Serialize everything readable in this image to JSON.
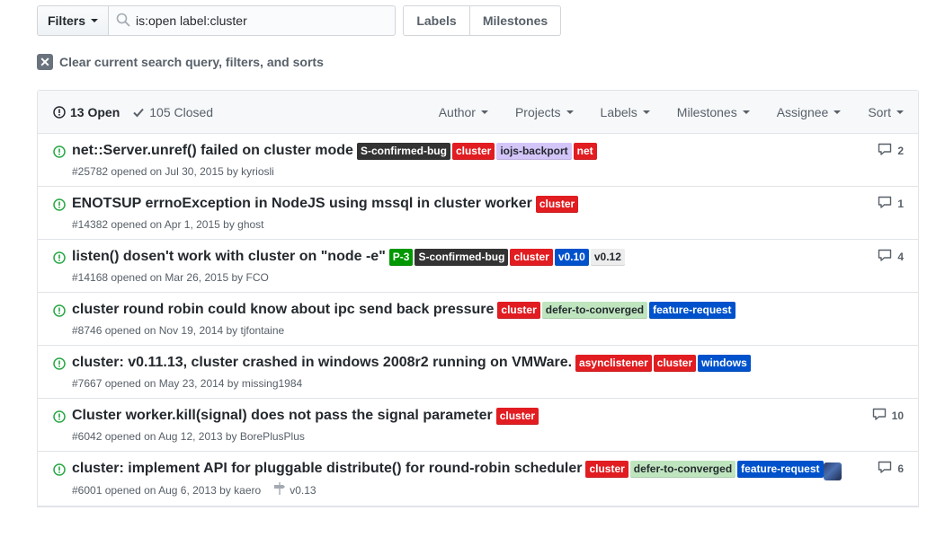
{
  "filter_bar": {
    "filters_label": "Filters",
    "search_value": "is:open label:cluster",
    "labels_button": "Labels",
    "milestones_button": "Milestones"
  },
  "clear_query": {
    "label": "Clear current search query, filters, and sorts"
  },
  "header": {
    "open_count": "13 Open",
    "closed_count": "105 Closed",
    "filters": [
      "Author",
      "Projects",
      "Labels",
      "Milestones",
      "Assignee",
      "Sort"
    ]
  },
  "colors": {
    "open_green": "#28a745",
    "S-confirmed-bug": "#333333",
    "cluster": "#e11d21",
    "iojs-backport": "#d4c5f9",
    "net": "#e11d21",
    "P-3": "#009800",
    "v0.10": "#0052cc",
    "v0.12": "#ededed",
    "defer-to-converged": "#bfe5bf",
    "feature-request": "#0052cc",
    "asynclistener": "#e11d21",
    "windows": "#0052cc"
  },
  "issues": [
    {
      "title": "net::Server.unref() failed on cluster mode",
      "labels": [
        {
          "name": "S-confirmed-bug",
          "bg": "#333333",
          "fg": "#ffffff"
        },
        {
          "name": "cluster",
          "bg": "#e11d21",
          "fg": "#ffffff"
        },
        {
          "name": "iojs-backport",
          "bg": "#d4c5f9",
          "fg": "#24292e"
        },
        {
          "name": "net",
          "bg": "#e11d21",
          "fg": "#ffffff"
        }
      ],
      "meta": "#25782 opened on Jul 30, 2015 by kyriosli",
      "comments": "2"
    },
    {
      "title": "ENOTSUP errnoException in NodeJS using mssql in cluster worker",
      "labels": [
        {
          "name": "cluster",
          "bg": "#e11d21",
          "fg": "#ffffff"
        }
      ],
      "meta": "#14382 opened on Apr 1, 2015 by ghost",
      "comments": "1"
    },
    {
      "title": "listen() dosen't work with cluster on \"node -e\"",
      "labels": [
        {
          "name": "P-3",
          "bg": "#009800",
          "fg": "#ffffff"
        },
        {
          "name": "S-confirmed-bug",
          "bg": "#333333",
          "fg": "#ffffff"
        },
        {
          "name": "cluster",
          "bg": "#e11d21",
          "fg": "#ffffff"
        },
        {
          "name": "v0.10",
          "bg": "#0052cc",
          "fg": "#ffffff"
        },
        {
          "name": "v0.12",
          "bg": "#ededed",
          "fg": "#24292e"
        }
      ],
      "meta": "#14168 opened on Mar 26, 2015 by FCO",
      "comments": "4"
    },
    {
      "title": "cluster round robin could know about ipc send back pressure",
      "labels": [
        {
          "name": "cluster",
          "bg": "#e11d21",
          "fg": "#ffffff"
        },
        {
          "name": "defer-to-converged",
          "bg": "#bfe5bf",
          "fg": "#24292e"
        },
        {
          "name": "feature-request",
          "bg": "#0052cc",
          "fg": "#ffffff"
        }
      ],
      "meta": "#8746 opened on Nov 19, 2014 by tjfontaine",
      "comments": ""
    },
    {
      "title": "cluster: v0.11.13, cluster crashed in windows 2008r2 running on VMWare.",
      "labels": [
        {
          "name": "asynclistener",
          "bg": "#e11d21",
          "fg": "#ffffff"
        },
        {
          "name": "cluster",
          "bg": "#e11d21",
          "fg": "#ffffff"
        },
        {
          "name": "windows",
          "bg": "#0052cc",
          "fg": "#ffffff"
        }
      ],
      "meta": "#7667 opened on May 23, 2014 by missing1984",
      "comments": ""
    },
    {
      "title": "Cluster worker.kill(signal) does not pass the signal parameter",
      "labels": [
        {
          "name": "cluster",
          "bg": "#e11d21",
          "fg": "#ffffff"
        }
      ],
      "meta": "#6042 opened on Aug 12, 2013 by BorePlusPlus",
      "comments": "10"
    },
    {
      "title": "cluster: implement API for pluggable distribute() for round-robin scheduler",
      "labels": [
        {
          "name": "cluster",
          "bg": "#e11d21",
          "fg": "#ffffff"
        },
        {
          "name": "defer-to-converged",
          "bg": "#bfe5bf",
          "fg": "#24292e"
        },
        {
          "name": "feature-request",
          "bg": "#0052cc",
          "fg": "#ffffff"
        }
      ],
      "meta": "#6001 opened on Aug 6, 2013 by kaero",
      "milestone": "v0.13",
      "comments": "6",
      "has_assignee": true
    }
  ]
}
